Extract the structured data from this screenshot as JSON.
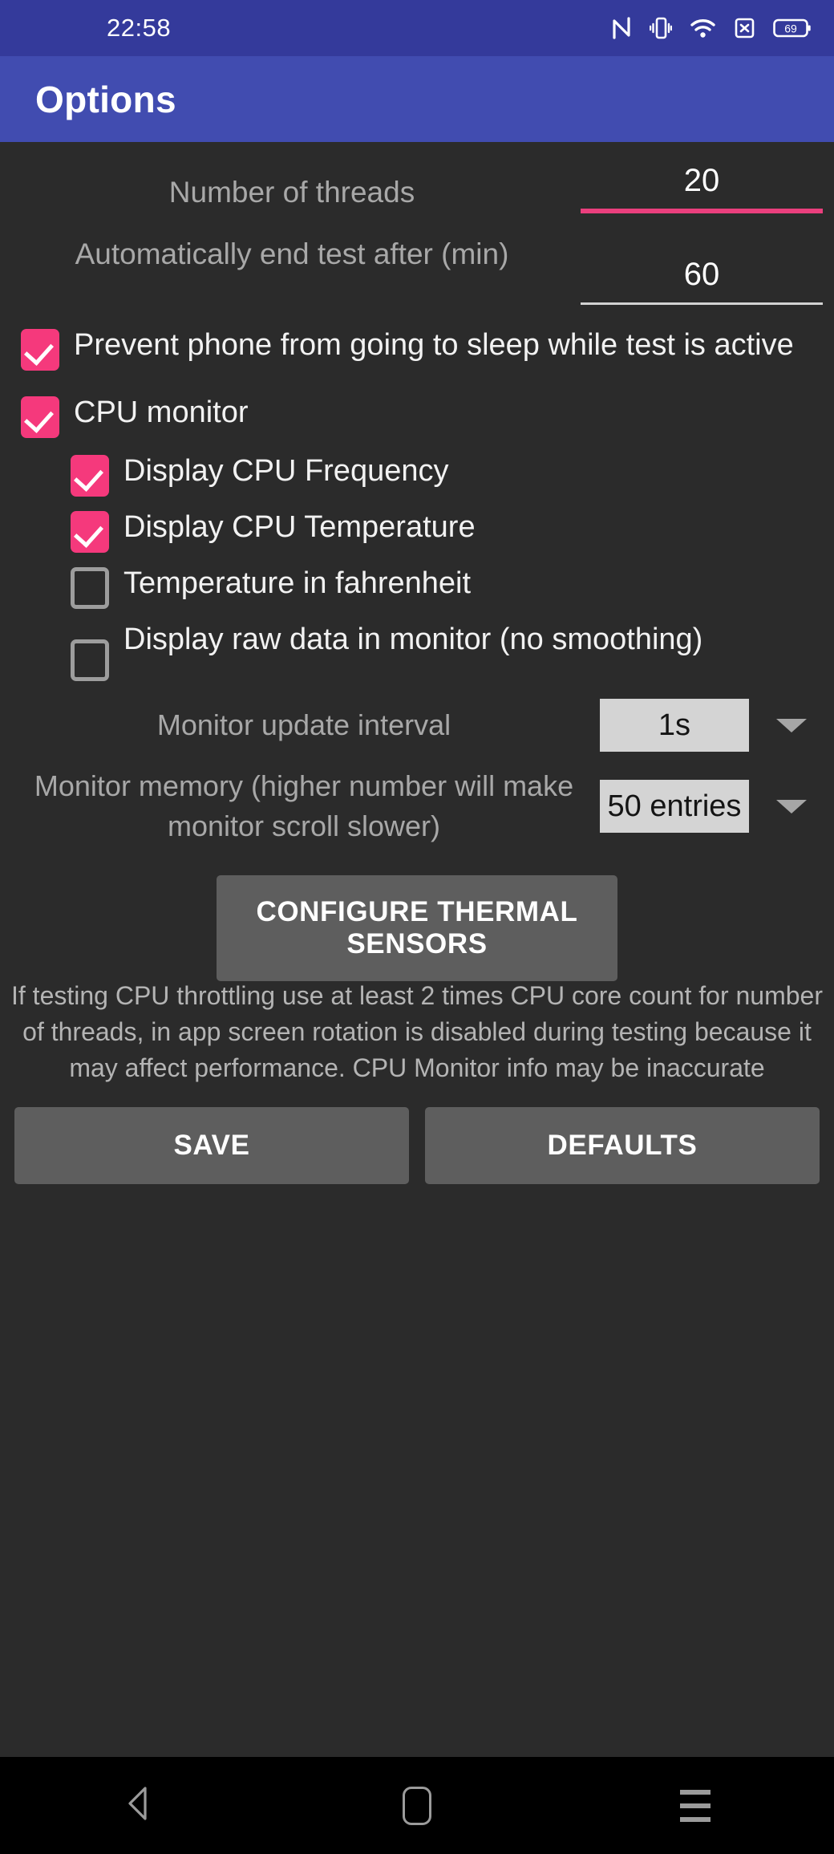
{
  "statusbar": {
    "time": "22:58",
    "icons": [
      {
        "name": "nfc-icon",
        "glyph": "N"
      },
      {
        "name": "vibrate-icon",
        "glyph": "vibrate"
      },
      {
        "name": "wifi-icon",
        "glyph": "wifi"
      },
      {
        "name": "sim-disabled-icon",
        "glyph": "x"
      },
      {
        "name": "battery-icon",
        "level": "69"
      }
    ],
    "bg_color": "#343a9b"
  },
  "appbar": {
    "title": "Options",
    "bg_color": "#414cb0"
  },
  "fields": [
    {
      "label": "Number of threads",
      "value": "20",
      "underline_color": "#ea3f7d",
      "focused": true
    },
    {
      "label": "Automatically end test after (min)",
      "value": "60",
      "underline_color": "#d2d2d2",
      "focused": false
    }
  ],
  "checkboxes": [
    {
      "label": "Prevent phone from going to sleep while test is active",
      "checked": true,
      "indent": false
    },
    {
      "label": "CPU monitor",
      "checked": true,
      "indent": false
    },
    {
      "label": "Display CPU Frequency",
      "checked": true,
      "indent": true
    },
    {
      "label": "Display CPU Temperature",
      "checked": true,
      "indent": true
    },
    {
      "label": "Temperature in fahrenheit",
      "checked": false,
      "indent": true
    },
    {
      "label": "Display raw data in monitor (no smoothing)",
      "checked": false,
      "indent": true
    }
  ],
  "spinners": [
    {
      "label": "Monitor update interval",
      "value": "1s"
    },
    {
      "label": "Monitor memory (higher number will make monitor scroll slower)",
      "value": "50 entries"
    }
  ],
  "thermal_button": {
    "label": "CONFIGURE THERMAL SENSORS"
  },
  "footnote": {
    "text": "If testing CPU throttling use at least 2 times CPU core count for number of threads, in app screen rotation is disabled during testing because it may affect performance. CPU Monitor info may be inaccurate"
  },
  "bottom_buttons": {
    "save": "SAVE",
    "defaults": "DEFAULTS"
  },
  "navbar": {
    "back": "back-icon",
    "home": "home-icon",
    "recents": "recents-icon"
  },
  "colors": {
    "accent_pink": "#f5397c",
    "background": "#2b2b2b",
    "button_gray": "#5e5e5e",
    "spinner_gray": "#d4d4d4"
  }
}
